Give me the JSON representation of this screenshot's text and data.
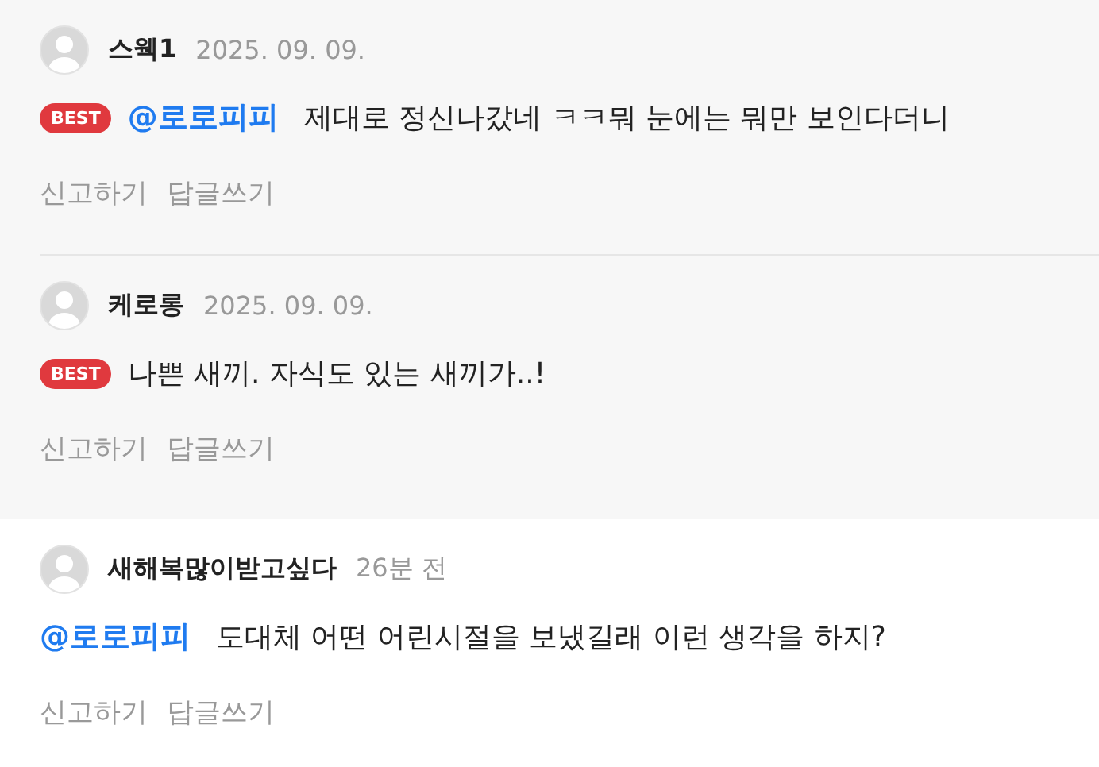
{
  "comments": [
    {
      "author": "스웩1",
      "date": "2025. 09. 09.",
      "badge": "BEST",
      "mention": "@로로피피",
      "text": "제대로 정신나갔네 ㅋㅋ뭐 눈에는 뭐만 보인다더니",
      "actions": [
        "신고하기",
        "답글쓰기"
      ]
    },
    {
      "author": "케로롱",
      "date": "2025. 09. 09.",
      "badge": "BEST",
      "text": "나쁜 새끼. 자식도 있는 새끼가..!",
      "actions": [
        "신고하기",
        "답글쓰기"
      ]
    },
    {
      "author": "새해복많이받고싶다",
      "date": "26분 전",
      "mention": "@로로피피",
      "text": "도대체 어떤 어린시절을 보냈길래 이런 생각을 하지?",
      "actions": [
        "신고하기",
        "답글쓰기"
      ]
    }
  ]
}
